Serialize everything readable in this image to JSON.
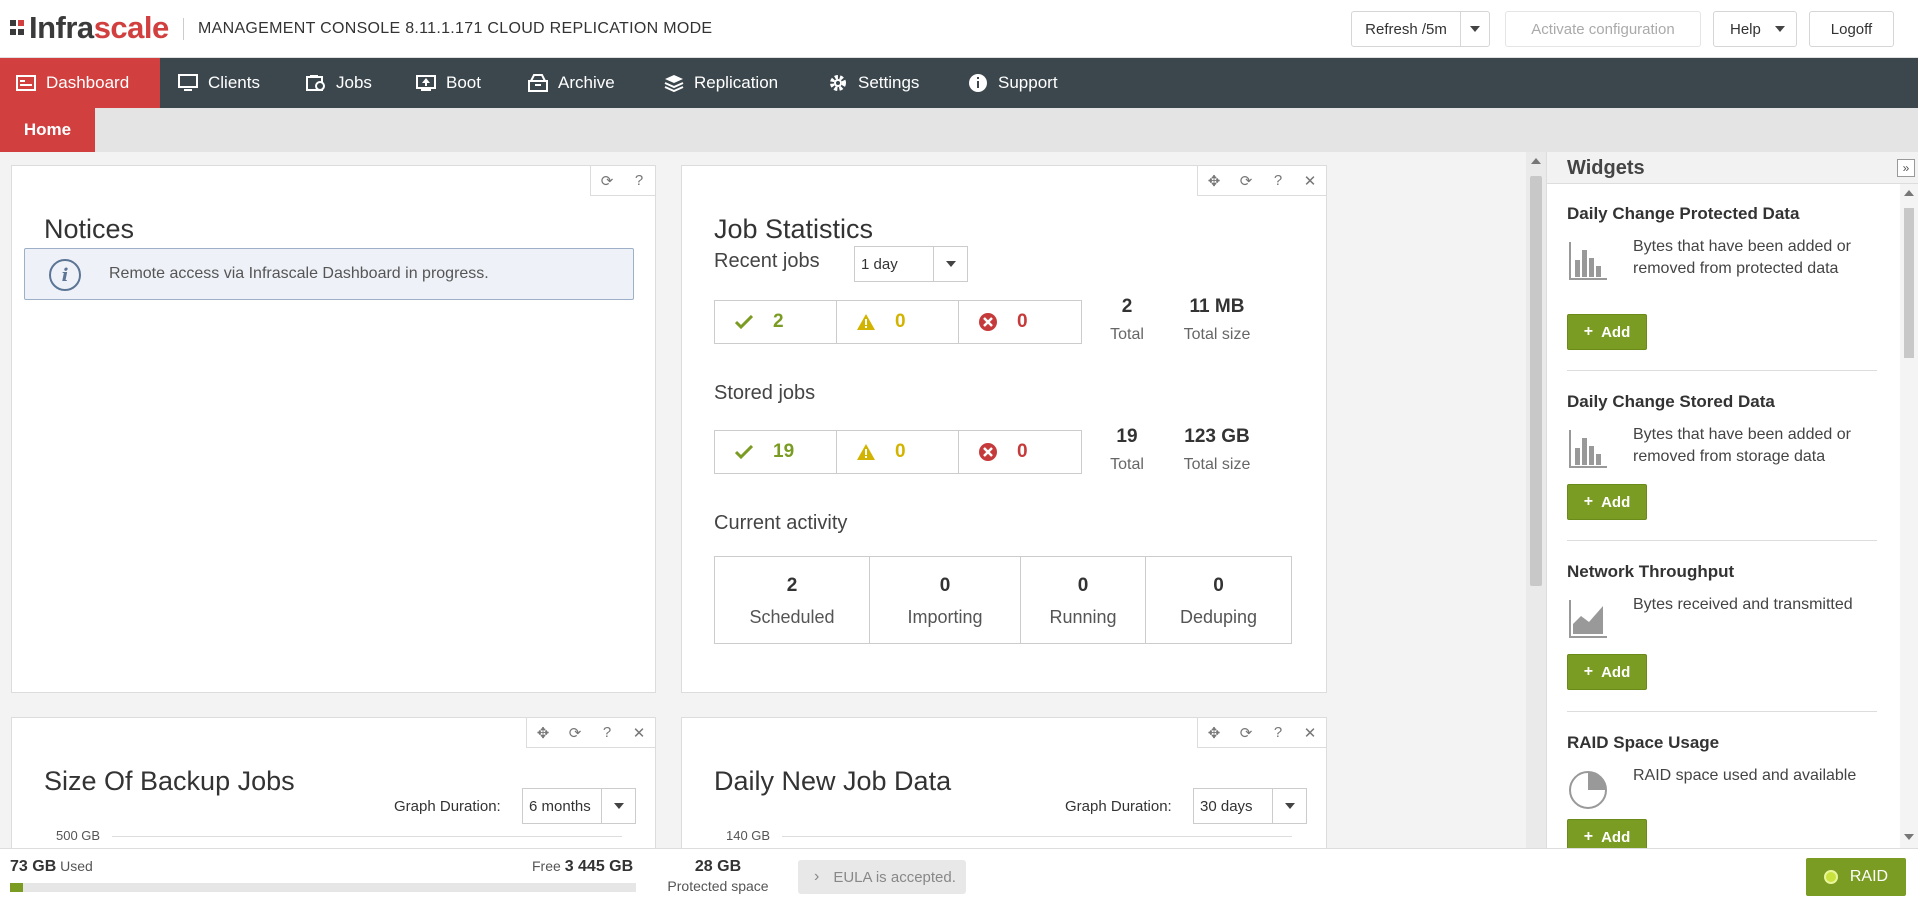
{
  "header": {
    "logo_prefix": "Infra",
    "logo_suffix": "scale",
    "console_title": "MANAGEMENT CONSOLE 8.11.1.171 CLOUD REPLICATION MODE",
    "refresh_label": "Refresh /5m",
    "activate_label": "Activate configuration",
    "help_label": "Help",
    "logoff_label": "Logoff"
  },
  "nav": {
    "items": [
      {
        "label": "Dashboard",
        "icon": "dashboard-icon"
      },
      {
        "label": "Clients",
        "icon": "monitor-icon"
      },
      {
        "label": "Jobs",
        "icon": "jobs-icon"
      },
      {
        "label": "Boot",
        "icon": "boot-icon"
      },
      {
        "label": "Archive",
        "icon": "archive-icon"
      },
      {
        "label": "Replication",
        "icon": "replication-icon"
      },
      {
        "label": "Settings",
        "icon": "gear-icon"
      },
      {
        "label": "Support",
        "icon": "info-icon"
      }
    ],
    "active": "Dashboard"
  },
  "subnav": {
    "home_label": "Home"
  },
  "notices": {
    "title": "Notices",
    "message": "Remote access via Infrascale Dashboard in progress."
  },
  "job_statistics": {
    "title": "Job Statistics",
    "recent_label": "Recent jobs",
    "recent_period": "1 day",
    "recent": {
      "ok": "2",
      "warn": "0",
      "err": "0",
      "total": "2",
      "total_label": "Total",
      "size": "11 MB",
      "size_label": "Total size"
    },
    "stored_label": "Stored jobs",
    "stored": {
      "ok": "19",
      "warn": "0",
      "err": "0",
      "total": "19",
      "total_label": "Total",
      "size": "123 GB",
      "size_label": "Total size"
    },
    "activity_label": "Current activity",
    "activity": [
      {
        "value": "2",
        "label": "Scheduled"
      },
      {
        "value": "0",
        "label": "Importing"
      },
      {
        "value": "0",
        "label": "Running"
      },
      {
        "value": "0",
        "label": "Deduping"
      }
    ]
  },
  "size_backup": {
    "title": "Size Of Backup Jobs",
    "duration_label": "Graph Duration:",
    "duration_value": "6 months",
    "y_top": "500 GB"
  },
  "daily_new": {
    "title": "Daily New Job Data",
    "duration_label": "Graph Duration:",
    "duration_value": "30 days",
    "y_top": "140 GB"
  },
  "widgets": {
    "title": "Widgets",
    "add_label": "Add",
    "items": [
      {
        "title": "Daily Change Protected Data",
        "desc": "Bytes that have been added or removed from protected data",
        "icon": "bar-chart-icon"
      },
      {
        "title": "Daily Change Stored Data",
        "desc": "Bytes that have been added or removed from storage data",
        "icon": "bar-chart-icon"
      },
      {
        "title": "Network Throughput",
        "desc": "Bytes received and transmitted",
        "icon": "line-chart-icon"
      },
      {
        "title": "RAID Space Usage",
        "desc": "RAID space used and available",
        "icon": "pie-chart-icon"
      }
    ]
  },
  "footer": {
    "used_value": "73 GB",
    "used_label": "Used",
    "free_label": "Free",
    "free_value": "3 445 GB",
    "usage_percent": 2.1,
    "protected_value": "28 GB",
    "protected_label": "Protected space",
    "eula_text": "EULA is accepted.",
    "raid_label": "RAID"
  },
  "colors": {
    "brand_red": "#d13f3f",
    "nav_dark": "#3b474d",
    "ok_green": "#7a9c22",
    "warn_yellow": "#d2b400",
    "err_red": "#c53a3a"
  }
}
